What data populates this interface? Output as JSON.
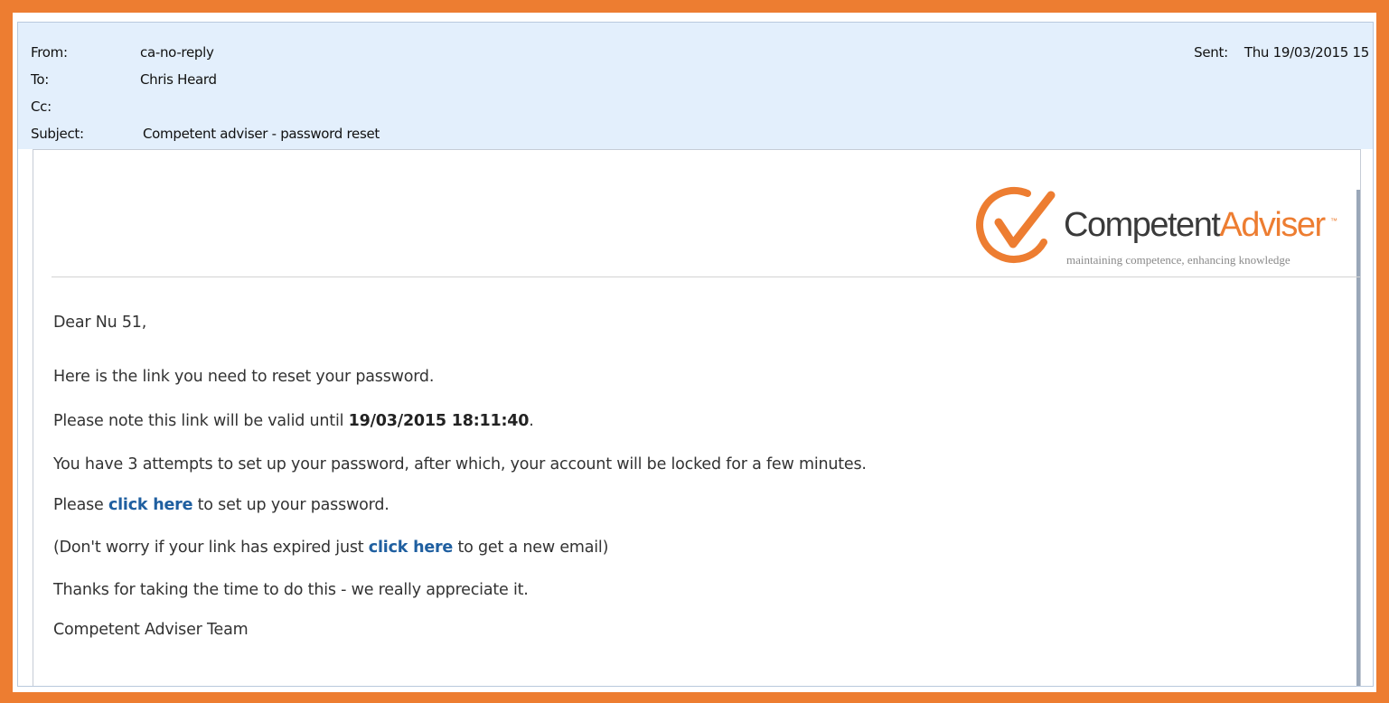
{
  "header": {
    "from_label": "From:",
    "from_value": "ca-no-reply",
    "to_label": "To:",
    "to_value": "Chris Heard",
    "cc_label": "Cc:",
    "cc_value": "",
    "subject_label": "Subject:",
    "subject_value": "Competent adviser - password reset",
    "sent_label": "Sent:",
    "sent_value": "Thu 19/03/2015 15"
  },
  "logo": {
    "name_part1": "Competent",
    "name_part2": "Adviser",
    "trademark": "™",
    "tagline": "maintaining competence, enhancing knowledge",
    "brand_color": "#ed7d31",
    "icon": "checkmark-circle-icon"
  },
  "body": {
    "greeting": "Dear Nu 51,",
    "line1": "Here is the link you need to reset your password.",
    "line2_prefix": "Please note this link will be valid until ",
    "line2_date": "19/03/2015 18:11:40",
    "line2_suffix": ".",
    "line3": "You have 3 attempts to set up your password, after which, your account will be locked for a few minutes.",
    "line4_prefix": "Please ",
    "line4_link": "click here",
    "line4_suffix": " to set up your password.",
    "line5_prefix": "(Don't worry if your link has expired just ",
    "line5_link": "click here",
    "line5_suffix": " to get a new email)",
    "line6": "Thanks for taking the time to do this - we really appreciate it.",
    "signature": "Competent Adviser Team"
  },
  "colors": {
    "frame": "#ed7d31",
    "header_bg": "#e3effc",
    "link": "#1f5fa0"
  }
}
